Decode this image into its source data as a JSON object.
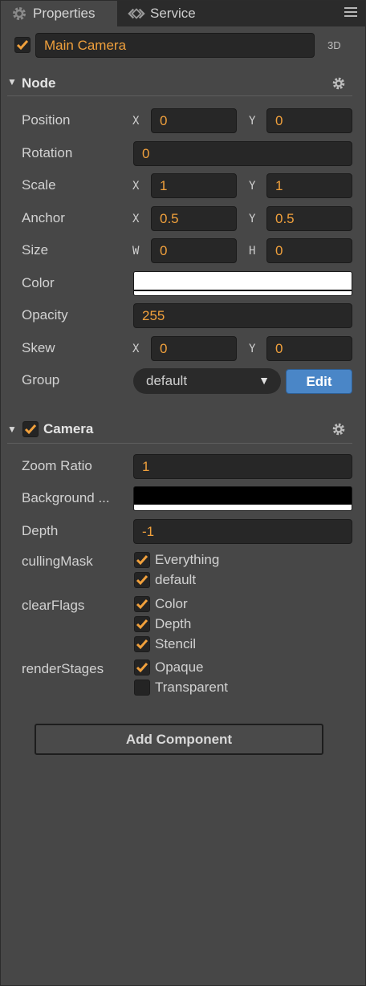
{
  "tabs": [
    {
      "label": "Properties",
      "icon": "gear-icon",
      "active": true
    },
    {
      "label": "Service",
      "icon": "cloud-link-icon",
      "active": false
    }
  ],
  "node_header": {
    "name": "Main Camera",
    "enabled": true,
    "badge": "3D"
  },
  "node_section": {
    "title": "Node",
    "position": {
      "label": "Position",
      "x_label": "X",
      "x": "0",
      "y_label": "Y",
      "y": "0"
    },
    "rotation": {
      "label": "Rotation",
      "value": "0"
    },
    "scale": {
      "label": "Scale",
      "x_label": "X",
      "x": "1",
      "y_label": "Y",
      "y": "1"
    },
    "anchor": {
      "label": "Anchor",
      "x_label": "X",
      "x": "0.5",
      "y_label": "Y",
      "y": "0.5"
    },
    "size": {
      "label": "Size",
      "w_label": "W",
      "w": "0",
      "h_label": "H",
      "h": "0"
    },
    "color": {
      "label": "Color",
      "value": "#ffffff"
    },
    "opacity": {
      "label": "Opacity",
      "value": "255"
    },
    "skew": {
      "label": "Skew",
      "x_label": "X",
      "x": "0",
      "y_label": "Y",
      "y": "0"
    },
    "group": {
      "label": "Group",
      "value": "default",
      "edit_label": "Edit"
    }
  },
  "camera_section": {
    "title": "Camera",
    "enabled": true,
    "zoom_ratio": {
      "label": "Zoom Ratio",
      "value": "1"
    },
    "background": {
      "label": "Background ...",
      "value": "#000000"
    },
    "depth": {
      "label": "Depth",
      "value": "-1"
    },
    "culling_mask": {
      "label": "cullingMask",
      "options": [
        {
          "label": "Everything",
          "checked": true
        },
        {
          "label": "default",
          "checked": true
        }
      ]
    },
    "clear_flags": {
      "label": "clearFlags",
      "options": [
        {
          "label": "Color",
          "checked": true
        },
        {
          "label": "Depth",
          "checked": true
        },
        {
          "label": "Stencil",
          "checked": true
        }
      ]
    },
    "render_stages": {
      "label": "renderStages",
      "options": [
        {
          "label": "Opaque",
          "checked": true
        },
        {
          "label": "Transparent",
          "checked": false
        }
      ]
    }
  },
  "add_component_label": "Add Component",
  "colors": {
    "accent": "#f0a03c",
    "button_blue": "#4a86c7",
    "panel": "#474747",
    "tabbar": "#2b2b2b"
  }
}
